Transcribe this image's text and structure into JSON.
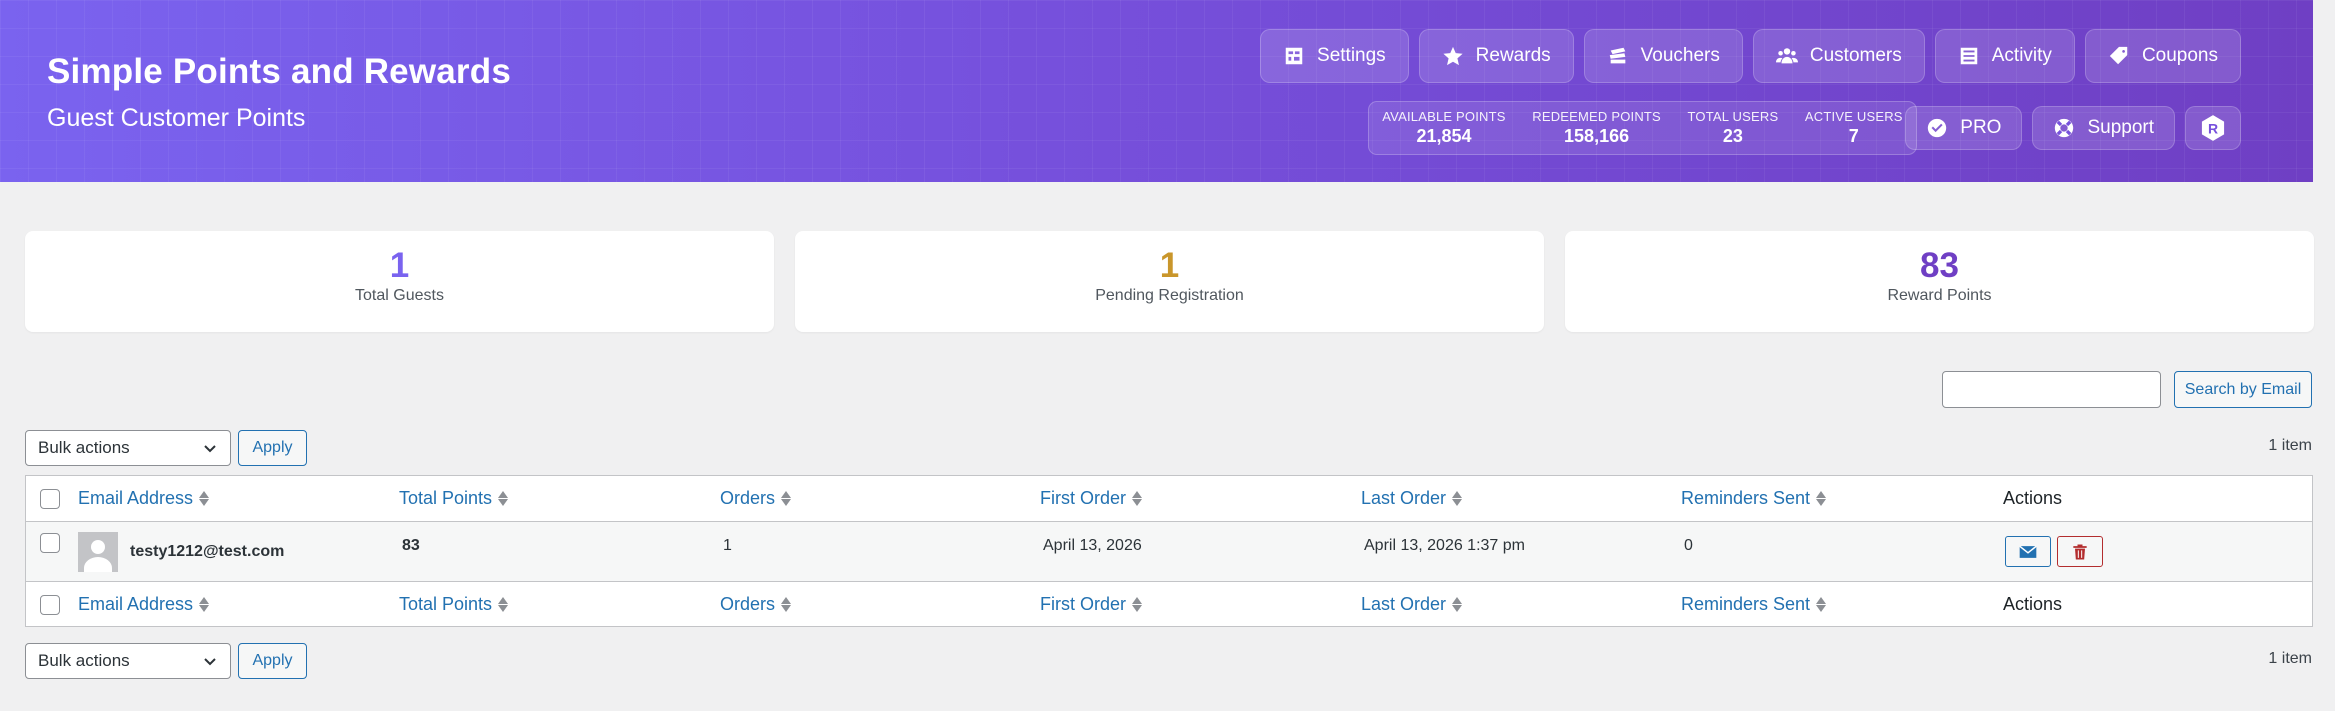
{
  "header": {
    "title": "Simple Points and Rewards",
    "subtitle": "Guest Customer Points",
    "nav": [
      "Settings",
      "Rewards",
      "Vouchers",
      "Customers",
      "Activity",
      "Coupons"
    ],
    "stats": [
      {
        "label": "AVAILABLE POINTS",
        "value": "21,854"
      },
      {
        "label": "REDEEMED POINTS",
        "value": "158,166"
      },
      {
        "label": "TOTAL USERS",
        "value": "23"
      },
      {
        "label": "ACTIVE USERS",
        "value": "7"
      }
    ],
    "pro_label": "PRO",
    "support_label": "Support",
    "logo_letter": "R"
  },
  "summary": [
    {
      "value": "1",
      "label": "Total Guests",
      "color": "#7a63ef"
    },
    {
      "value": "1",
      "label": "Pending Registration",
      "color": "#c9962b"
    },
    {
      "value": "83",
      "label": "Reward Points",
      "color": "#6f3fc4"
    }
  ],
  "search": {
    "button_label": "Search by Email",
    "value": ""
  },
  "bulk": {
    "select_label": "Bulk actions",
    "apply_label": "Apply",
    "item_count": "1 item"
  },
  "table": {
    "columns": [
      "Email Address",
      "Total Points",
      "Orders",
      "First Order",
      "Last Order",
      "Reminders Sent",
      "Actions"
    ],
    "rows": [
      {
        "email": "testy1212@test.com",
        "points": "83",
        "orders": "1",
        "first_order": "April 13, 2026",
        "last_order": "April 13, 2026 1:37 pm",
        "reminders": "0"
      }
    ]
  },
  "colors": {
    "accent": "#7650dc",
    "link": "#2271b1",
    "danger": "#b32d2e"
  }
}
